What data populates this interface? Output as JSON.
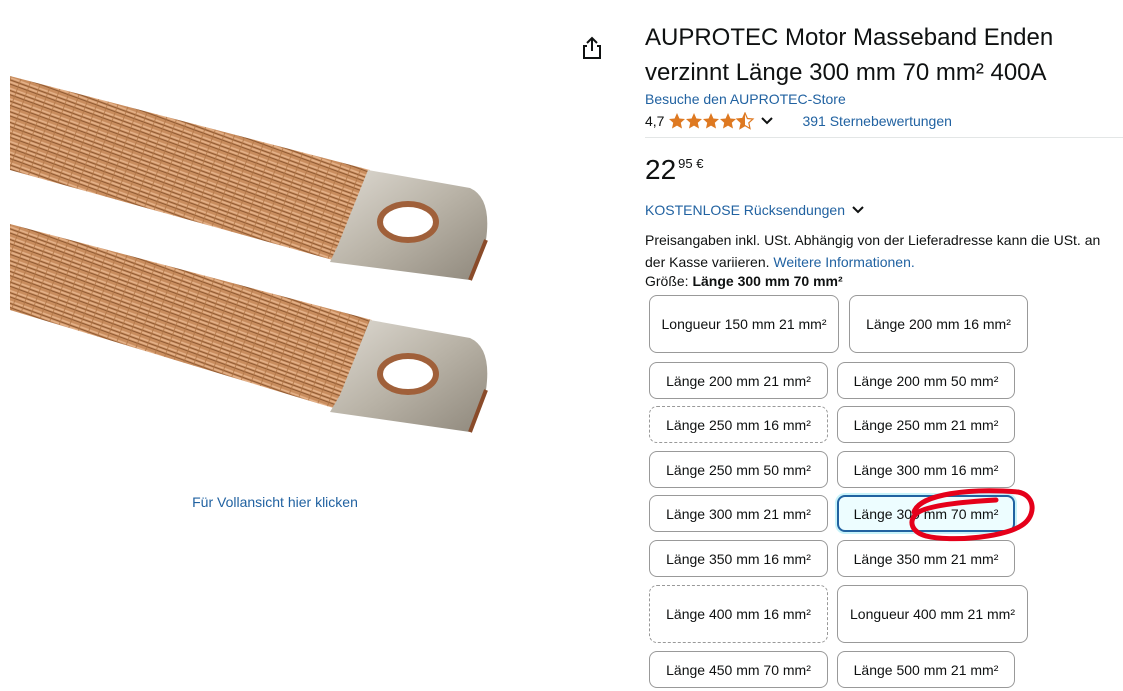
{
  "product": {
    "title": "AUPROTEC Motor Masseband Enden verzinnt Länge 300 mm 70 mm² 400A",
    "store_link": "Besuche den AUPROTEC-Store",
    "rating_value": "4,7",
    "ratings_count_text": "391 Sternebewertungen",
    "price_whole": "22",
    "price_fraction": "95 €",
    "returns_text": "KOSTENLOSE Rücksendungen",
    "price_note": "Preisangaben inkl. USt. Abhängig von der Lieferadresse kann die USt. an der Kasse variieren.",
    "more_info_link": "Weitere Informationen.",
    "full_view_link": "Für Vollansicht hier klicken"
  },
  "size": {
    "label": "Größe:",
    "selected": "Länge 300 mm 70 mm²",
    "options": [
      {
        "label": "Longueur 150 mm 21 mm²",
        "state": "available"
      },
      {
        "label": "Länge 200 mm 16 mm²",
        "state": "available"
      },
      {
        "label": "Länge 200 mm 21 mm²",
        "state": "available"
      },
      {
        "label": "Länge 200 mm 50 mm²",
        "state": "available"
      },
      {
        "label": "Länge 250 mm 16 mm²",
        "state": "unavailable"
      },
      {
        "label": "Länge 250 mm 21 mm²",
        "state": "available"
      },
      {
        "label": "Länge 250 mm 50 mm²",
        "state": "available"
      },
      {
        "label": "Länge 300 mm 16 mm²",
        "state": "available"
      },
      {
        "label": "Länge 300 mm 21 mm²",
        "state": "available"
      },
      {
        "label": "Länge 300 mm 70 mm²",
        "state": "selected"
      },
      {
        "label": "Länge 350 mm 16 mm²",
        "state": "available"
      },
      {
        "label": "Länge 350 mm 21 mm²",
        "state": "available"
      },
      {
        "label": "Länge 400 mm 16 mm²",
        "state": "unavailable"
      },
      {
        "label": "Longueur 400 mm 21 mm²",
        "state": "available"
      },
      {
        "label": "Länge 450 mm 70 mm²",
        "state": "available"
      },
      {
        "label": "Länge 500 mm 21 mm²",
        "state": "available"
      }
    ]
  },
  "colors": {
    "link": "#2162a1",
    "star": "#de7921",
    "annotation": "#e5001a",
    "selected_border": "#2162a1"
  },
  "icons": [
    "share-icon",
    "star-icon",
    "chevron-down-icon"
  ],
  "annotation": "red-hand-drawn-circle"
}
